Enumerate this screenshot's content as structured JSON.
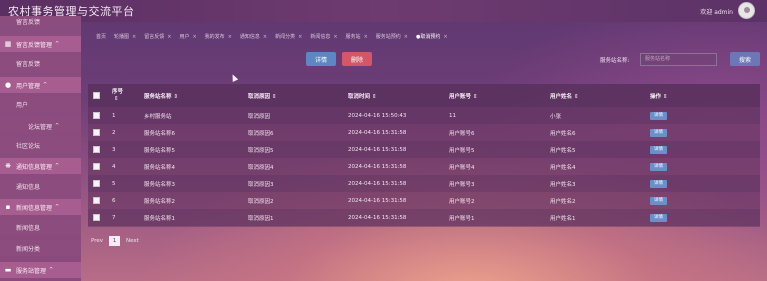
{
  "app": {
    "title": "农村事务管理与交流平台",
    "welcome": "欢迎 admin"
  },
  "sidebar": {
    "top_label": "留言反馈",
    "groups": [
      {
        "label": "留言反馈管理",
        "icon": "grid-icon",
        "items": [
          "留言反馈"
        ]
      },
      {
        "label": "用户管理",
        "icon": "user-icon",
        "items": [
          "用户"
        ]
      },
      {
        "label": "论坛管理",
        "icon": "",
        "items": [
          "社区论坛"
        ]
      },
      {
        "label": "通知信息管理",
        "icon": "settings-icon",
        "items": [
          "通知信息"
        ]
      },
      {
        "label": "新闻信息管理",
        "icon": "apps-icon",
        "items": [
          "新闻信息",
          "新闻分类"
        ]
      },
      {
        "label": "服务站管理",
        "icon": "list-icon",
        "items": []
      }
    ]
  },
  "tabs": [
    "首页",
    "轮播图",
    "留言反馈",
    "用户",
    "我的发布",
    "通知信息",
    "新闻分类",
    "新闻信息",
    "服务站",
    "服务站预约",
    "●取消预约"
  ],
  "toolbar": {
    "detail_label": "详情",
    "delete_label": "删除",
    "search_label": "服务站名称:",
    "search_placeholder": "服务站名称",
    "search_button": "搜索"
  },
  "table": {
    "headers": [
      "序号",
      "服务站名称",
      "取消原因",
      "取消时间",
      "用户账号",
      "用户姓名",
      "操作"
    ],
    "detail_button": "详情",
    "rows": [
      {
        "no": "1",
        "name": "乡村服务站",
        "reason": "取消原因",
        "time": "2024-04-16 15:50:43",
        "account": "11",
        "user": "小张"
      },
      {
        "no": "2",
        "name": "服务站名称6",
        "reason": "取消原因6",
        "time": "2024-04-16 15:31:58",
        "account": "用户账号6",
        "user": "用户姓名6"
      },
      {
        "no": "3",
        "name": "服务站名称5",
        "reason": "取消原因5",
        "time": "2024-04-16 15:31:58",
        "account": "用户账号5",
        "user": "用户姓名5"
      },
      {
        "no": "4",
        "name": "服务站名称4",
        "reason": "取消原因4",
        "time": "2024-04-16 15:31:58",
        "account": "用户账号4",
        "user": "用户姓名4"
      },
      {
        "no": "5",
        "name": "服务站名称3",
        "reason": "取消原因3",
        "time": "2024-04-16 15:31:58",
        "account": "用户账号3",
        "user": "用户姓名3"
      },
      {
        "no": "6",
        "name": "服务站名称2",
        "reason": "取消原因2",
        "time": "2024-04-16 15:31:58",
        "account": "用户账号2",
        "user": "用户姓名2"
      },
      {
        "no": "7",
        "name": "服务站名称1",
        "reason": "取消原因1",
        "time": "2024-04-16 15:31:58",
        "account": "用户账号1",
        "user": "用户姓名1"
      }
    ]
  },
  "pager": {
    "prev": "Prev",
    "current": "1",
    "next": "Next"
  }
}
